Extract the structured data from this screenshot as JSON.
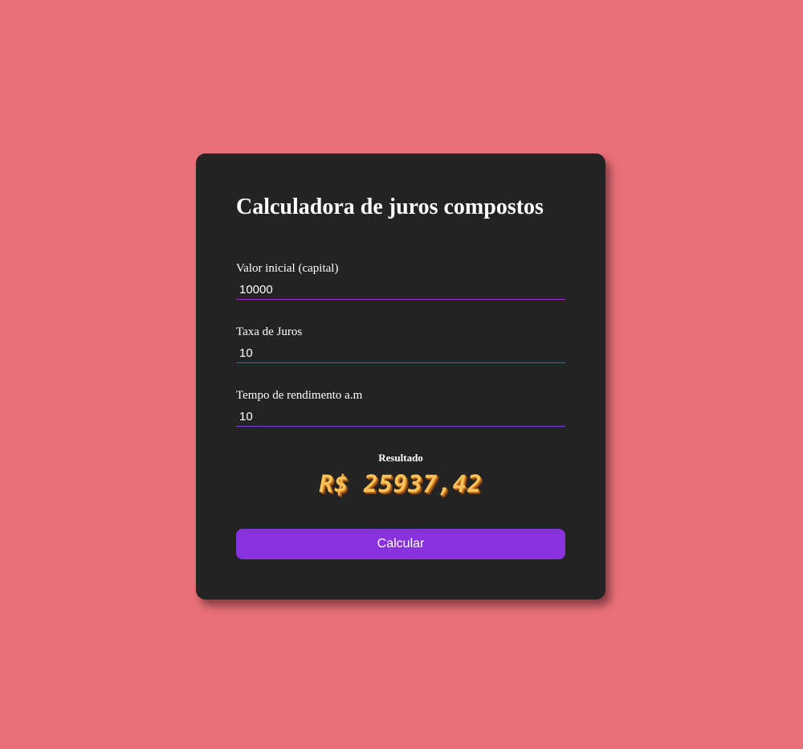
{
  "calculator": {
    "title": "Calculadora de juros compostos",
    "fields": [
      {
        "label": "Valor inicial (capital)",
        "value": "10000"
      },
      {
        "label": "Taxa de Juros",
        "value": "10"
      },
      {
        "label": "Tempo de rendimento a.m",
        "value": "10"
      }
    ],
    "result_label": "Resultado",
    "result_value": "R$ 25937,42",
    "button_label": "Calcular"
  },
  "colors": {
    "page_background": "#e87078",
    "card_background": "#232323",
    "accent": "#8732dc",
    "result_text": "#f7c25a"
  }
}
